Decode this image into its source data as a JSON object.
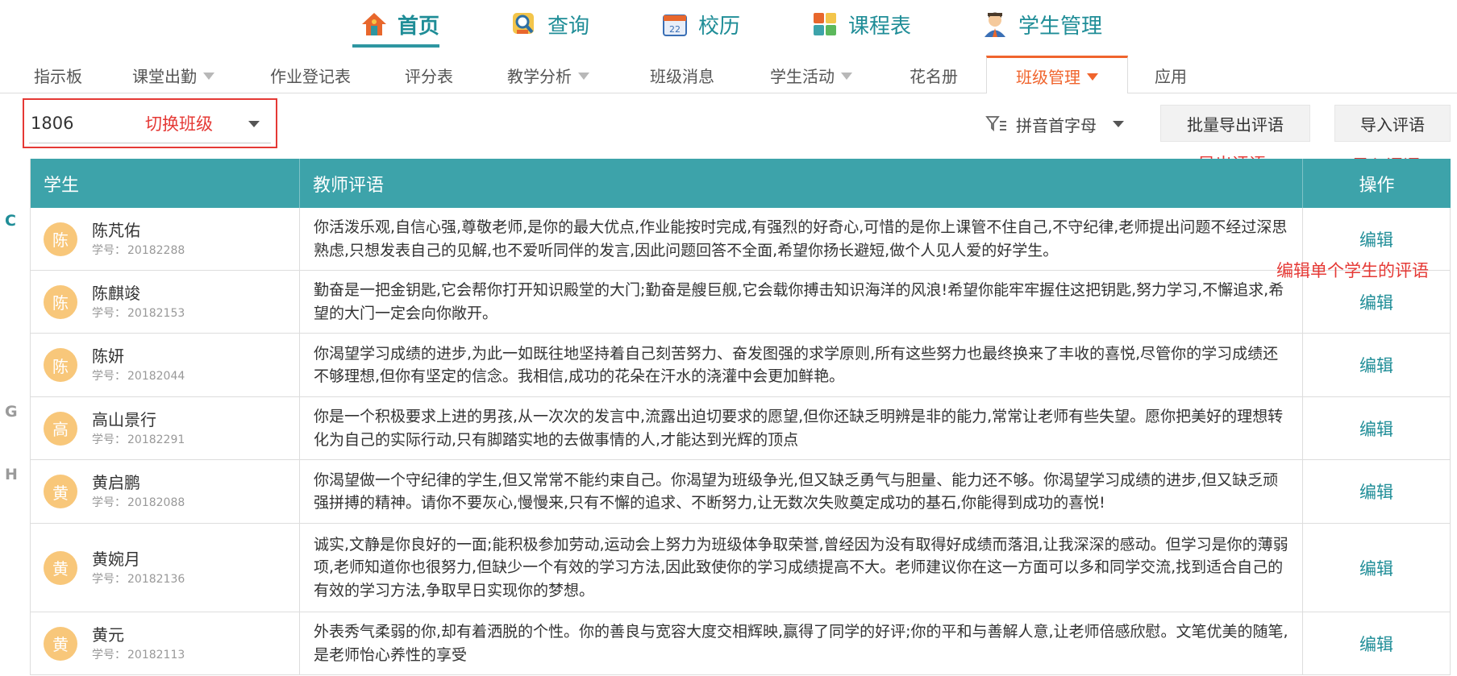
{
  "nav": {
    "items": [
      {
        "label": "首页",
        "icon": "home-icon"
      },
      {
        "label": "查询",
        "icon": "search-person-icon"
      },
      {
        "label": "校历",
        "icon": "calendar-icon"
      },
      {
        "label": "课程表",
        "icon": "timetable-icon"
      },
      {
        "label": "学生管理",
        "icon": "student-icon"
      }
    ],
    "active": "首页"
  },
  "subtabs": {
    "items": [
      {
        "label": "指示板",
        "dropdown": false
      },
      {
        "label": "课堂出勤",
        "dropdown": true
      },
      {
        "label": "作业登记表",
        "dropdown": false
      },
      {
        "label": "评分表",
        "dropdown": false
      },
      {
        "label": "教学分析",
        "dropdown": true
      },
      {
        "label": "班级消息",
        "dropdown": false
      },
      {
        "label": "学生活动",
        "dropdown": true
      },
      {
        "label": "花名册",
        "dropdown": false
      },
      {
        "label": "班级管理",
        "dropdown": true
      },
      {
        "label": "应用",
        "dropdown": false
      }
    ],
    "active": "班级管理"
  },
  "toolbar": {
    "class_value": "1806",
    "sort_label": "拼音首字母",
    "export_button": "批量导出评语",
    "import_button": "导入评语"
  },
  "annotations": {
    "switch_class": "切换班级",
    "export": "导出评语",
    "import": "导入评语",
    "edit_single": "编辑单个学生的评语"
  },
  "letter_index": [
    "C",
    "G",
    "H"
  ],
  "table": {
    "headers": {
      "student": "学生",
      "comment": "教师评语",
      "action": "操作"
    },
    "id_prefix": "学号：",
    "edit_label": "编辑",
    "rows": [
      {
        "avatar": "陈",
        "name": "陈芃佑",
        "id": "20182288",
        "comment": "你活泼乐观,自信心强,尊敬老师,是你的最大优点,作业能按时完成,有强烈的好奇心,可惜的是你上课管不住自己,不守纪律,老师提出问题不经过深思熟虑,只想发表自己的见解,也不爱听同伴的发言,因此问题回答不全面,希望你扬长避短,做个人见人爱的好学生。"
      },
      {
        "avatar": "陈",
        "name": "陈麒竣",
        "id": "20182153",
        "comment": "勤奋是一把金钥匙,它会帮你打开知识殿堂的大门;勤奋是艘巨舰,它会载你搏击知识海洋的风浪!希望你能牢牢握住这把钥匙,努力学习,不懈追求,希望的大门一定会向你敞开。"
      },
      {
        "avatar": "陈",
        "name": "陈妍",
        "id": "20182044",
        "comment": "你渴望学习成绩的进步,为此一如既往地坚持着自己刻苦努力、奋发图强的求学原则,所有这些努力也最终换来了丰收的喜悦,尽管你的学习成绩还不够理想,但你有坚定的信念。我相信,成功的花朵在汗水的浇灌中会更加鲜艳。"
      },
      {
        "avatar": "高",
        "name": "高山景行",
        "id": "20182291",
        "comment": "你是一个积极要求上进的男孩,从一次次的发言中,流露出迫切要求的愿望,但你还缺乏明辨是非的能力,常常让老师有些失望。愿你把美好的理想转化为自己的实际行动,只有脚踏实地的去做事情的人,才能达到光辉的顶点"
      },
      {
        "avatar": "黄",
        "name": "黄启鹏",
        "id": "20182088",
        "comment": "你渴望做一个守纪律的学生,但又常常不能约束自己。你渴望为班级争光,但又缺乏勇气与胆量、能力还不够。你渴望学习成绩的进步,但又缺乏顽强拼搏的精神。请你不要灰心,慢慢来,只有不懈的追求、不断努力,让无数次失败奠定成功的基石,你能得到成功的喜悦!"
      },
      {
        "avatar": "黄",
        "name": "黄婉月",
        "id": "20182136",
        "comment": "诚实,文静是你良好的一面;能积极参加劳动,运动会上努力为班级体争取荣誉,曾经因为没有取得好成绩而落泪,让我深深的感动。但学习是你的薄弱项,老师知道你也很努力,但缺少一个有效的学习方法,因此致使你的学习成绩提高不大。老师建议你在这一方面可以多和同学交流,找到适合自己的有效的学习方法,争取早日实现你的梦想。"
      },
      {
        "avatar": "黄",
        "name": "黄元",
        "id": "20182113",
        "comment": "外表秀气柔弱的你,却有着洒脱的个性。你的善良与宽容大度交相辉映,赢得了同学的好评;你的平和与善解人意,让老师倍感欣慰。文笔优美的随笔,是老师怡心养性的享受"
      }
    ]
  },
  "colors": {
    "accent": "#3da3aa",
    "active_tab": "#f0642d",
    "annotation": "#e53935",
    "avatar": "#f8c77a"
  }
}
